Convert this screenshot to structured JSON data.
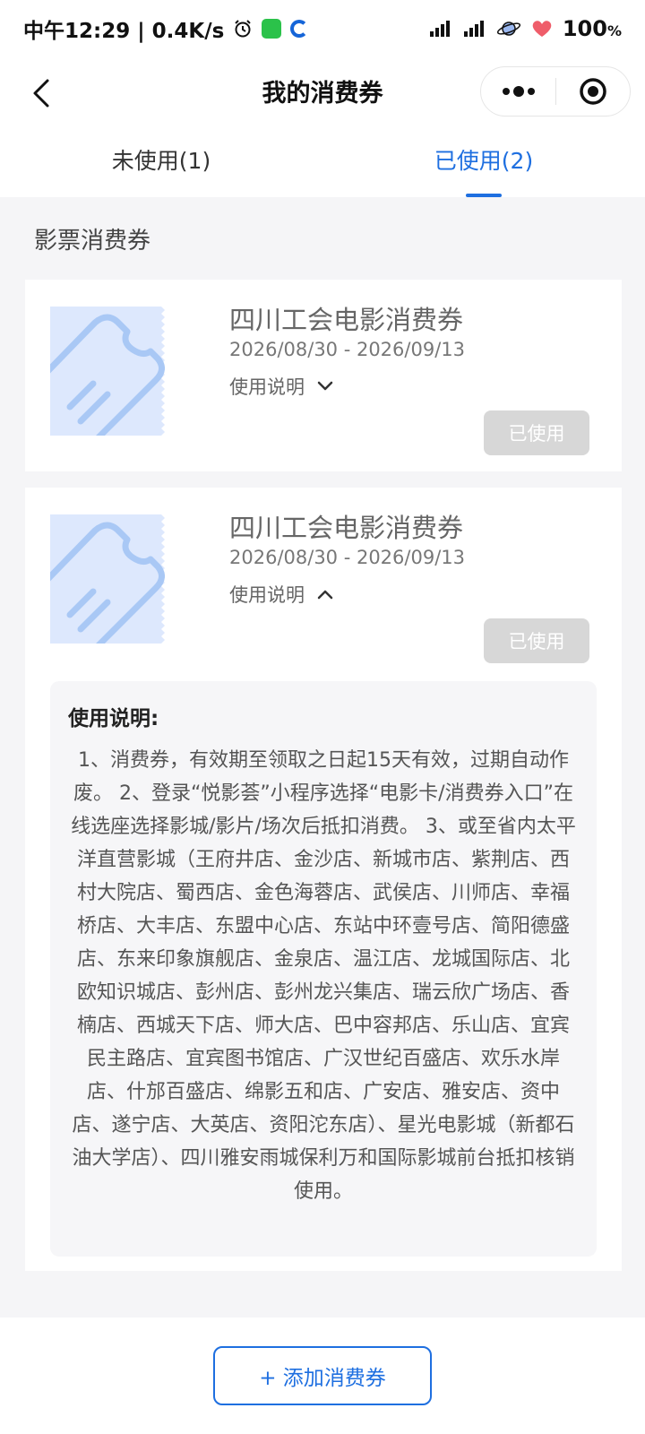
{
  "status_bar": {
    "time_speed": "中午12:29 | 0.4K/s",
    "battery": "100",
    "battery_unit": "%"
  },
  "nav": {
    "title": "我的消费券"
  },
  "tabs": [
    {
      "label": "未使用(1)",
      "active": false
    },
    {
      "label": "已使用(2)",
      "active": true
    }
  ],
  "section": {
    "title": "影票消费券"
  },
  "coupons": [
    {
      "name": "四川工会电影消费券",
      "date_range": "2026/08/30 - 2026/09/13",
      "instructions_label": "使用说明",
      "expanded": false,
      "status_label": "已使用"
    },
    {
      "name": "四川工会电影消费券",
      "date_range": "2026/08/30 - 2026/09/13",
      "instructions_label": "使用说明",
      "expanded": true,
      "status_label": "已使用",
      "instructions_heading": "使用说明:",
      "instructions_text": "1、消费券，有效期至领取之日起15天有效，过期自动作废。 2、登录“悦影荟”小程序选择“电影卡/消费券入口”在线选座选择影城/影片/场次后抵扣消费。 3、或至省内太平洋直营影城（王府井店、金沙店、新城市店、紫荆店、西村大院店、蜀西店、金色海蓉店、武侯店、川师店、幸福桥店、大丰店、东盟中心店、东站中环壹号店、简阳德盛店、东来印象旗舰店、金泉店、温江店、龙城国际店、北欧知识城店、彭州店、彭州龙兴集店、瑞云欣广场店、香楠店、西城天下店、师大店、巴中容邦店、乐山店、宜宾民主路店、宜宾图书馆店、广汉世纪百盛店、欢乐水岸店、什邡百盛店、绵影五和店、广安店、雅安店、资中店、遂宁店、大英店、资阳沱东店）、星光电影城（新都石油大学店）、四川雅安雨城保利万和国际影城前台抵扣核销使用。"
    }
  ],
  "bottom": {
    "add_button_label": "+ 添加消费券"
  },
  "colors": {
    "accent": "#1e6fe0",
    "used_button": "#d7d7d7",
    "thumb_bg": "#dde8fd",
    "thumb_stroke": "#a9c8f5"
  },
  "icons": {
    "back": "chevron-left-icon",
    "more": "more-dots-icon",
    "close": "target-close-icon",
    "expand": "chevron-down-icon",
    "collapse": "chevron-up-icon",
    "coupon": "ticket-icon"
  }
}
